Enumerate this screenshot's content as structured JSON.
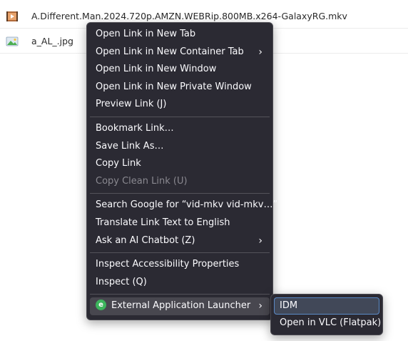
{
  "files": [
    {
      "name": "A.Different.Man.2024.720p.AMZN.WEBRip.800MB.x264-GalaxyRG.mkv",
      "icon": "video-file-icon"
    },
    {
      "name": "a_AL_.jpg",
      "icon": "image-file-icon"
    }
  ],
  "context_menu": {
    "items": [
      {
        "label": "Open Link in New Tab"
      },
      {
        "label": "Open Link in New Container Tab",
        "arrow": "›"
      },
      {
        "label": "Open Link in New Window"
      },
      {
        "label": "Open Link in New Private Window"
      },
      {
        "label": "Preview Link (J)"
      },
      {
        "label": "Bookmark Link…"
      },
      {
        "label": "Save Link As…"
      },
      {
        "label": "Copy Link"
      },
      {
        "label": "Copy Clean Link (U)"
      },
      {
        "label": "Search Google for “vid-mkv vid-mkv…”"
      },
      {
        "label": "Translate Link Text to English"
      },
      {
        "label": "Ask an AI Chatbot (Z)",
        "arrow": "›"
      },
      {
        "label": "Inspect Accessibility Properties"
      },
      {
        "label": "Inspect (Q)"
      },
      {
        "label": "External Application Launcher",
        "arrow": "›",
        "badge": "e"
      }
    ]
  },
  "submenu": {
    "items": [
      {
        "label": "IDM"
      },
      {
        "label": "Open in VLC (Flatpak)"
      }
    ]
  },
  "colors": {
    "menu_bg": "#2b2a33",
    "menu_text": "#fbfbfe",
    "disabled_text": "#8a8990",
    "highlight_bg": "#48474f",
    "active_border": "#5a8ac6",
    "badge_green": "#3cb55c"
  }
}
